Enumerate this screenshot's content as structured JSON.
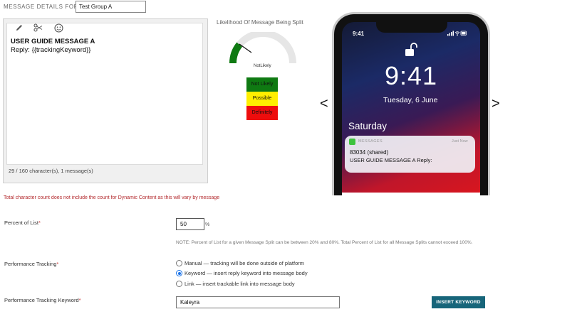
{
  "header": {
    "label": "MESSAGE DETAILS FOR",
    "group_name": "Test Group A"
  },
  "editor": {
    "toolbar_icons": [
      "pencil-icon",
      "scissors-icon",
      "smiley-icon"
    ],
    "line1": "USER GUIDE MESSAGE A",
    "line2": "Reply: {{trackingKeyword}}",
    "char_count": "29 / 160 character(s), 1 message(s)"
  },
  "dynamic_note": "Total character count does not include the count for Dynamic Content as this will vary by message",
  "gauge": {
    "title": "Likelihood Of Message Being Split",
    "value_label": "NotLikely",
    "legend": [
      "Not Likely",
      "Possible",
      "Definitely"
    ],
    "colors": {
      "green": "#0f7a12",
      "yellow": "#ffee00",
      "red": "#ee0d0d",
      "track": "#e6e6e6"
    }
  },
  "phone": {
    "status_time": "9:41",
    "lock_time": "9:41",
    "date": "Tuesday, 6 June",
    "day": "Saturday",
    "notification": {
      "app": "MESSAGES",
      "time": "Just Now",
      "from": "83034 (shared)",
      "body": "USER GUIDE MESSAGE A Reply:"
    },
    "prev_symbol": "<",
    "next_symbol": ">"
  },
  "form": {
    "percent_label": "Percent of List",
    "percent_value": "50",
    "percent_sign": "%",
    "percent_note": "NOTE: Percent of List for a given Message Split can be between 20% and 80%. Total Percent of List for all Message Splits cannot exceed 100%.",
    "tracking_label": "Performance Tracking",
    "tracking_options": [
      {
        "label": "Manual — tracking will be done outside of platform",
        "selected": false
      },
      {
        "label": "Keyword — insert reply keyword into message body",
        "selected": true
      },
      {
        "label": "Link — insert trackable link into message body",
        "selected": false
      }
    ],
    "keyword_label": "Performance Tracking Keyword",
    "keyword_value": "Kaleyra",
    "insert_button": "INSERT KEYWORD",
    "required_mark": "*"
  }
}
